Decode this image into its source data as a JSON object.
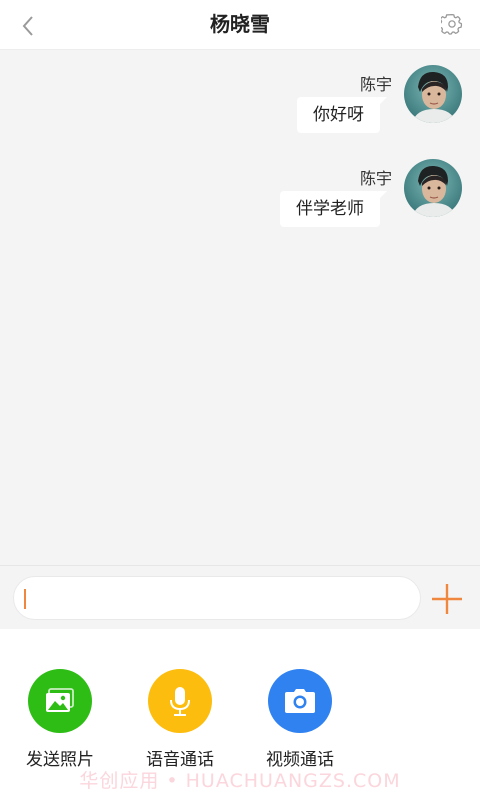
{
  "header": {
    "title": "杨晓雪",
    "back_icon": "chevron-left-icon",
    "settings_icon": "gear-icon"
  },
  "messages": [
    {
      "sender": "陈宇",
      "text": "你好呀",
      "avatar": "user-avatar"
    },
    {
      "sender": "陈宇",
      "text": "伴学老师",
      "avatar": "user-avatar"
    }
  ],
  "input": {
    "value": "",
    "placeholder": "",
    "plus_icon": "plus-icon"
  },
  "actions": [
    {
      "label": "发送照片",
      "icon": "photo-icon",
      "color": "#2dbd15"
    },
    {
      "label": "语音通话",
      "icon": "microphone-icon",
      "color": "#fdbd0e"
    },
    {
      "label": "视频通话",
      "icon": "camera-icon",
      "color": "#2f82f0"
    }
  ],
  "colors": {
    "accent": "#f0873f",
    "chat_background": "#f4f4f4"
  },
  "watermark": "华创应用 • HUACHUANGZS.COM"
}
